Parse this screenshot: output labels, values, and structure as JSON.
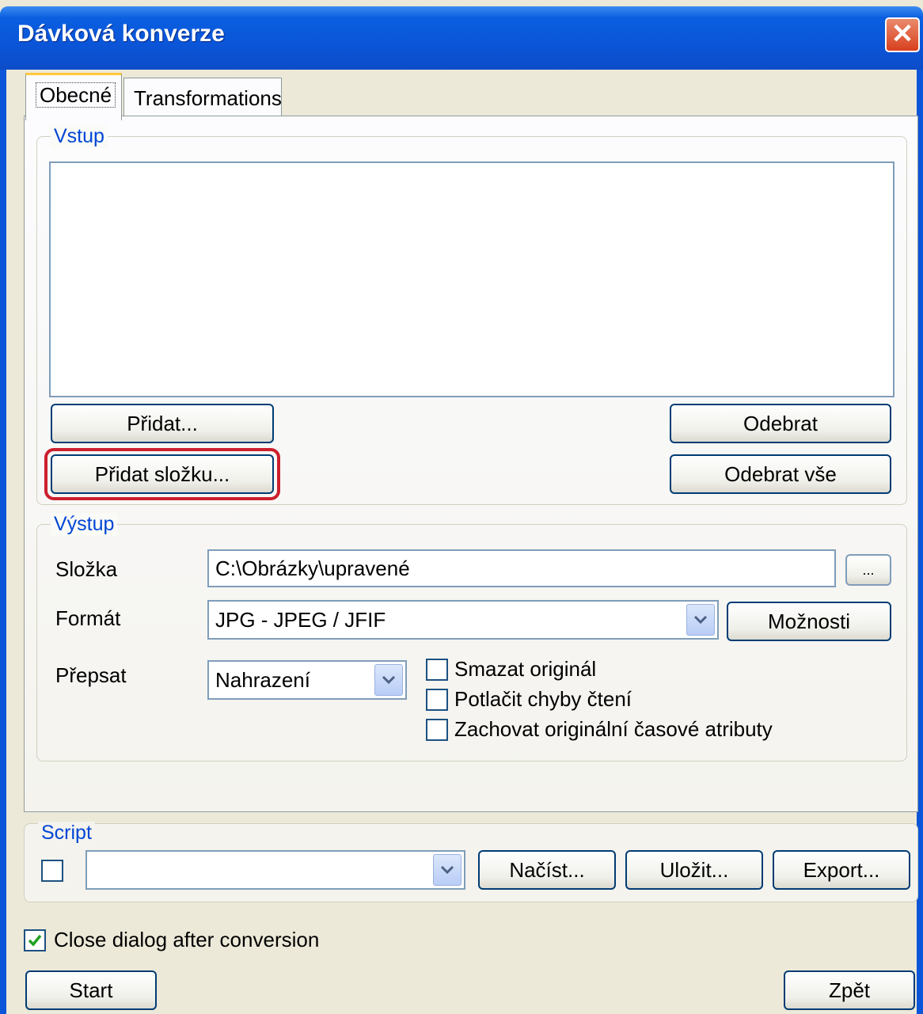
{
  "window": {
    "title": "Dávková konverze",
    "close_glyph": "✕"
  },
  "tabs": [
    {
      "label": "Obecné",
      "active": true
    },
    {
      "label": "Transformations",
      "active": false
    }
  ],
  "input_group": {
    "label": "Vstup",
    "add_button": "Přidat...",
    "add_folder_button": "Přidat složku...",
    "remove_button": "Odebrat",
    "remove_all_button": "Odebrat vše"
  },
  "output_group": {
    "label": "Výstup",
    "folder_label": "Složka",
    "folder_value": "C:\\Obrázky\\upravené",
    "browse_button": "...",
    "format_label": "Formát",
    "format_value": "JPG - JPEG / JFIF",
    "options_button": "Možnosti",
    "overwrite_label": "Přepsat",
    "overwrite_value": "Nahrazení",
    "checkboxes": [
      {
        "label": "Smazat originál",
        "checked": false
      },
      {
        "label": "Potlačit chyby čtení",
        "checked": false
      },
      {
        "label": "Zachovat originální časové atributy",
        "checked": false
      }
    ]
  },
  "script_group": {
    "label": "Script",
    "enabled": false,
    "value": "",
    "load_button": "Načíst...",
    "save_button": "Uložit...",
    "export_button": "Export..."
  },
  "close_after": {
    "label": "Close dialog after conversion",
    "checked": true
  },
  "footer": {
    "start_button": "Start",
    "back_button": "Zpět"
  },
  "icons": {
    "dropdown": "chevron-down-icon",
    "check": "checkmark-icon"
  },
  "colors": {
    "highlight": "#cc1f2d",
    "titlebar": "#0b55d8",
    "group_label": "#0046d5"
  }
}
